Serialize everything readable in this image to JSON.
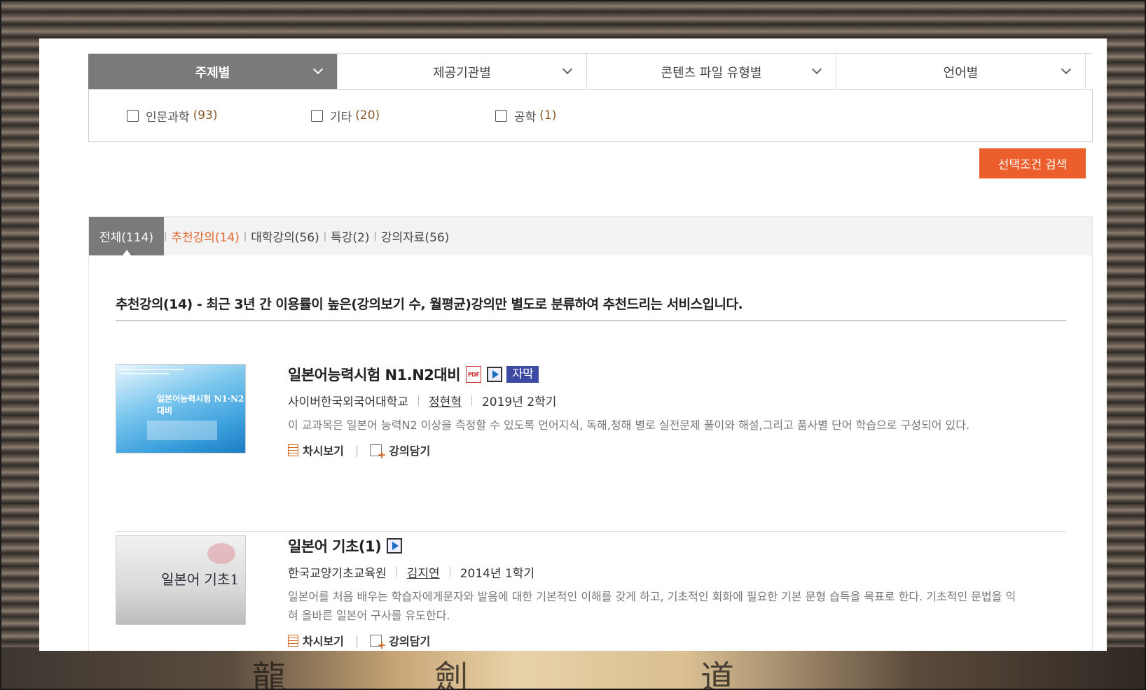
{
  "filter_tabs": [
    {
      "label": "주제별",
      "active": true
    },
    {
      "label": "제공기관별",
      "active": false
    },
    {
      "label": "콘텐츠 파일 유형별",
      "active": false
    },
    {
      "label": "언어별",
      "active": false
    }
  ],
  "filter_options": [
    {
      "label": "인문과학",
      "count": "(93)",
      "checked": false
    },
    {
      "label": "기타",
      "count": "(20)",
      "checked": false
    },
    {
      "label": "공학",
      "count": "(1)",
      "checked": false
    }
  ],
  "search_button": "선택조건 검색",
  "content_tabs": [
    {
      "label": "전체(114)",
      "active": true
    },
    {
      "label": "추천강의(14)",
      "highlight": true
    },
    {
      "label": "대학강의(56)"
    },
    {
      "label": "특강(2)"
    },
    {
      "label": "강의자료(56)"
    }
  ],
  "notice": "추천강의(14) - 최근 3년 간 이용률이 높은(강의보기 수, 월평균)강의만 별도로 분류하여 추천드리는 서비스입니다.",
  "courses": [
    {
      "title": "일본어능력시험 N1.N2대비",
      "icons": [
        "pdf-icon",
        "video-icon"
      ],
      "badge": "자막",
      "institution": "사이버한국외국어대학교",
      "professor": "정현혁",
      "term": "2019년 2학기",
      "description": "이 교과목은 일본어 능력N2 이상을 측정할 수 있도록 언어지식, 독해,청해 별로 실전문제 풀이와 해설,그리고 품사별 단어 학습으로 구성되어 있다.",
      "thumb_text": "일본어능력시험 N1·N2 대비",
      "actions": [
        "차시보기",
        "강의담기"
      ]
    },
    {
      "title": "일본어 기초(1)",
      "icons": [
        "video-icon"
      ],
      "institution": "한국교양기초교육원",
      "professor": "김지연",
      "term": "2014년 1학기",
      "description": "일본어를 처음 배우는 학습자에게문자와 발음에 대한 기본적인 이해를 갖게 하고, 기초적인 회화에 필요한 기본 문형 습득을 목표로 한다. 기초적인 문법을 익혀 올바른 일본어 구사를 유도한다.",
      "thumb_text": "일본어 기초1",
      "actions": [
        "차시보기",
        "강의담기"
      ]
    }
  ],
  "colors": {
    "accent": "#ec5f2c",
    "active_tab": "#7a7a7a",
    "badge": "#3d4aa3"
  }
}
